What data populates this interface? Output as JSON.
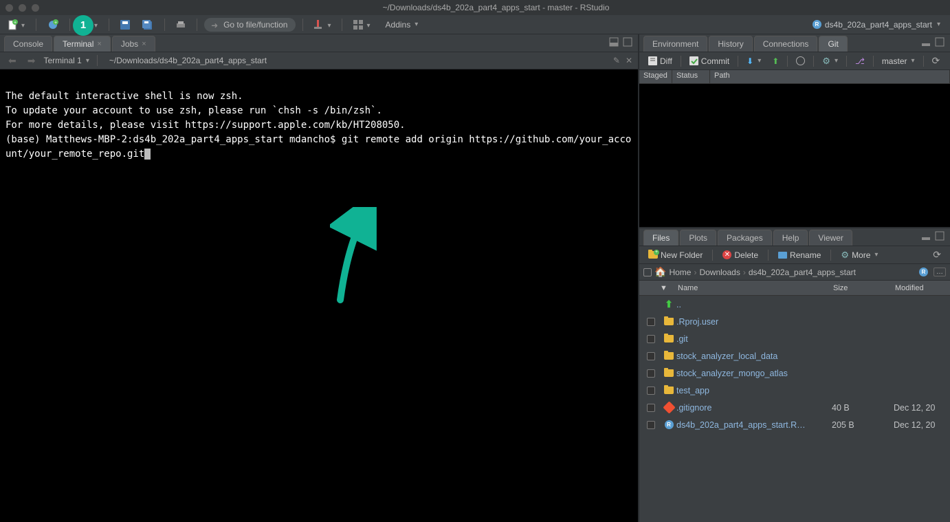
{
  "window": {
    "title": "~/Downloads/ds4b_202a_part4_apps_start - master - RStudio"
  },
  "toolbar": {
    "goto_placeholder": "Go to file/function",
    "addins_label": "Addins",
    "project_name": "ds4b_202a_part4_apps_start",
    "badge": "1"
  },
  "left_pane": {
    "tabs": {
      "console": "Console",
      "terminal": "Terminal",
      "jobs": "Jobs"
    },
    "terminal_selector": "Terminal 1",
    "path": "~/Downloads/ds4b_202a_part4_apps_start",
    "terminal_output": "\nThe default interactive shell is now zsh.\nTo update your account to use zsh, please run `chsh -s /bin/zsh`.\nFor more details, please visit https://support.apple.com/kb/HT208050.\n(base) Matthews-MBP-2:ds4b_202a_part4_apps_start mdancho$ git remote add origin https://github.com/your_account/your_remote_repo.git"
  },
  "right_top": {
    "tabs": {
      "env": "Environment",
      "history": "History",
      "connections": "Connections",
      "git": "Git"
    },
    "git_toolbar": {
      "diff": "Diff",
      "commit": "Commit",
      "branch": "master"
    },
    "git_headers": {
      "staged": "Staged",
      "status": "Status",
      "path": "Path"
    }
  },
  "right_bottom": {
    "tabs": {
      "files": "Files",
      "plots": "Plots",
      "packages": "Packages",
      "help": "Help",
      "viewer": "Viewer"
    },
    "buttons": {
      "new_folder": "New Folder",
      "delete": "Delete",
      "rename": "Rename",
      "more": "More"
    },
    "breadcrumb": [
      "Home",
      "Downloads",
      "ds4b_202a_part4_apps_start"
    ],
    "headers": {
      "name": "Name",
      "size": "Size",
      "modified": "Modified"
    },
    "rows": [
      {
        "icon": "up",
        "name": "..",
        "size": "",
        "modified": ""
      },
      {
        "icon": "folder",
        "name": ".Rproj.user",
        "size": "",
        "modified": ""
      },
      {
        "icon": "folder",
        "name": ".git",
        "size": "",
        "modified": ""
      },
      {
        "icon": "folder",
        "name": "stock_analyzer_local_data",
        "size": "",
        "modified": ""
      },
      {
        "icon": "folder",
        "name": "stock_analyzer_mongo_atlas",
        "size": "",
        "modified": ""
      },
      {
        "icon": "folder",
        "name": "test_app",
        "size": "",
        "modified": ""
      },
      {
        "icon": "git",
        "name": ".gitignore",
        "size": "40 B",
        "modified": "Dec 12, 20"
      },
      {
        "icon": "rproj",
        "name": "ds4b_202a_part4_apps_start.R…",
        "size": "205 B",
        "modified": "Dec 12, 20"
      }
    ]
  }
}
